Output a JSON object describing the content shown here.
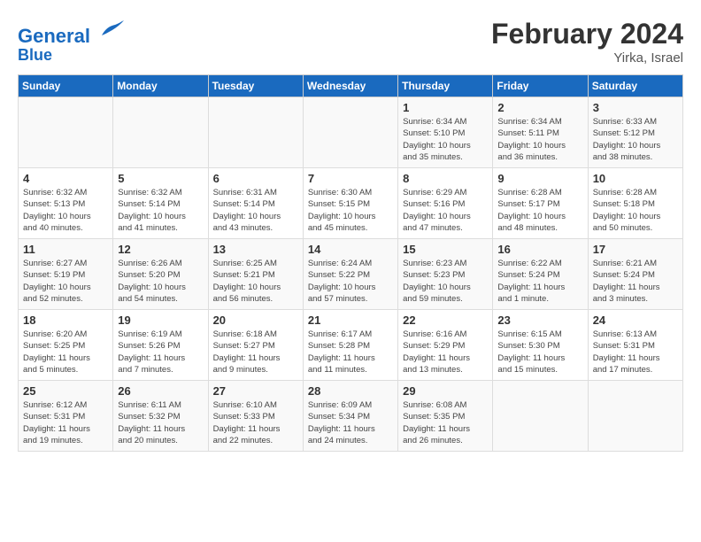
{
  "header": {
    "logo_line1": "General",
    "logo_line2": "Blue",
    "month_title": "February 2024",
    "location": "Yirka, Israel"
  },
  "weekdays": [
    "Sunday",
    "Monday",
    "Tuesday",
    "Wednesday",
    "Thursday",
    "Friday",
    "Saturday"
  ],
  "weeks": [
    [
      {
        "day": "",
        "info": ""
      },
      {
        "day": "",
        "info": ""
      },
      {
        "day": "",
        "info": ""
      },
      {
        "day": "",
        "info": ""
      },
      {
        "day": "1",
        "info": "Sunrise: 6:34 AM\nSunset: 5:10 PM\nDaylight: 10 hours\nand 35 minutes."
      },
      {
        "day": "2",
        "info": "Sunrise: 6:34 AM\nSunset: 5:11 PM\nDaylight: 10 hours\nand 36 minutes."
      },
      {
        "day": "3",
        "info": "Sunrise: 6:33 AM\nSunset: 5:12 PM\nDaylight: 10 hours\nand 38 minutes."
      }
    ],
    [
      {
        "day": "4",
        "info": "Sunrise: 6:32 AM\nSunset: 5:13 PM\nDaylight: 10 hours\nand 40 minutes."
      },
      {
        "day": "5",
        "info": "Sunrise: 6:32 AM\nSunset: 5:14 PM\nDaylight: 10 hours\nand 41 minutes."
      },
      {
        "day": "6",
        "info": "Sunrise: 6:31 AM\nSunset: 5:14 PM\nDaylight: 10 hours\nand 43 minutes."
      },
      {
        "day": "7",
        "info": "Sunrise: 6:30 AM\nSunset: 5:15 PM\nDaylight: 10 hours\nand 45 minutes."
      },
      {
        "day": "8",
        "info": "Sunrise: 6:29 AM\nSunset: 5:16 PM\nDaylight: 10 hours\nand 47 minutes."
      },
      {
        "day": "9",
        "info": "Sunrise: 6:28 AM\nSunset: 5:17 PM\nDaylight: 10 hours\nand 48 minutes."
      },
      {
        "day": "10",
        "info": "Sunrise: 6:28 AM\nSunset: 5:18 PM\nDaylight: 10 hours\nand 50 minutes."
      }
    ],
    [
      {
        "day": "11",
        "info": "Sunrise: 6:27 AM\nSunset: 5:19 PM\nDaylight: 10 hours\nand 52 minutes."
      },
      {
        "day": "12",
        "info": "Sunrise: 6:26 AM\nSunset: 5:20 PM\nDaylight: 10 hours\nand 54 minutes."
      },
      {
        "day": "13",
        "info": "Sunrise: 6:25 AM\nSunset: 5:21 PM\nDaylight: 10 hours\nand 56 minutes."
      },
      {
        "day": "14",
        "info": "Sunrise: 6:24 AM\nSunset: 5:22 PM\nDaylight: 10 hours\nand 57 minutes."
      },
      {
        "day": "15",
        "info": "Sunrise: 6:23 AM\nSunset: 5:23 PM\nDaylight: 10 hours\nand 59 minutes."
      },
      {
        "day": "16",
        "info": "Sunrise: 6:22 AM\nSunset: 5:24 PM\nDaylight: 11 hours\nand 1 minute."
      },
      {
        "day": "17",
        "info": "Sunrise: 6:21 AM\nSunset: 5:24 PM\nDaylight: 11 hours\nand 3 minutes."
      }
    ],
    [
      {
        "day": "18",
        "info": "Sunrise: 6:20 AM\nSunset: 5:25 PM\nDaylight: 11 hours\nand 5 minutes."
      },
      {
        "day": "19",
        "info": "Sunrise: 6:19 AM\nSunset: 5:26 PM\nDaylight: 11 hours\nand 7 minutes."
      },
      {
        "day": "20",
        "info": "Sunrise: 6:18 AM\nSunset: 5:27 PM\nDaylight: 11 hours\nand 9 minutes."
      },
      {
        "day": "21",
        "info": "Sunrise: 6:17 AM\nSunset: 5:28 PM\nDaylight: 11 hours\nand 11 minutes."
      },
      {
        "day": "22",
        "info": "Sunrise: 6:16 AM\nSunset: 5:29 PM\nDaylight: 11 hours\nand 13 minutes."
      },
      {
        "day": "23",
        "info": "Sunrise: 6:15 AM\nSunset: 5:30 PM\nDaylight: 11 hours\nand 15 minutes."
      },
      {
        "day": "24",
        "info": "Sunrise: 6:13 AM\nSunset: 5:31 PM\nDaylight: 11 hours\nand 17 minutes."
      }
    ],
    [
      {
        "day": "25",
        "info": "Sunrise: 6:12 AM\nSunset: 5:31 PM\nDaylight: 11 hours\nand 19 minutes."
      },
      {
        "day": "26",
        "info": "Sunrise: 6:11 AM\nSunset: 5:32 PM\nDaylight: 11 hours\nand 20 minutes."
      },
      {
        "day": "27",
        "info": "Sunrise: 6:10 AM\nSunset: 5:33 PM\nDaylight: 11 hours\nand 22 minutes."
      },
      {
        "day": "28",
        "info": "Sunrise: 6:09 AM\nSunset: 5:34 PM\nDaylight: 11 hours\nand 24 minutes."
      },
      {
        "day": "29",
        "info": "Sunrise: 6:08 AM\nSunset: 5:35 PM\nDaylight: 11 hours\nand 26 minutes."
      },
      {
        "day": "",
        "info": ""
      },
      {
        "day": "",
        "info": ""
      }
    ]
  ]
}
